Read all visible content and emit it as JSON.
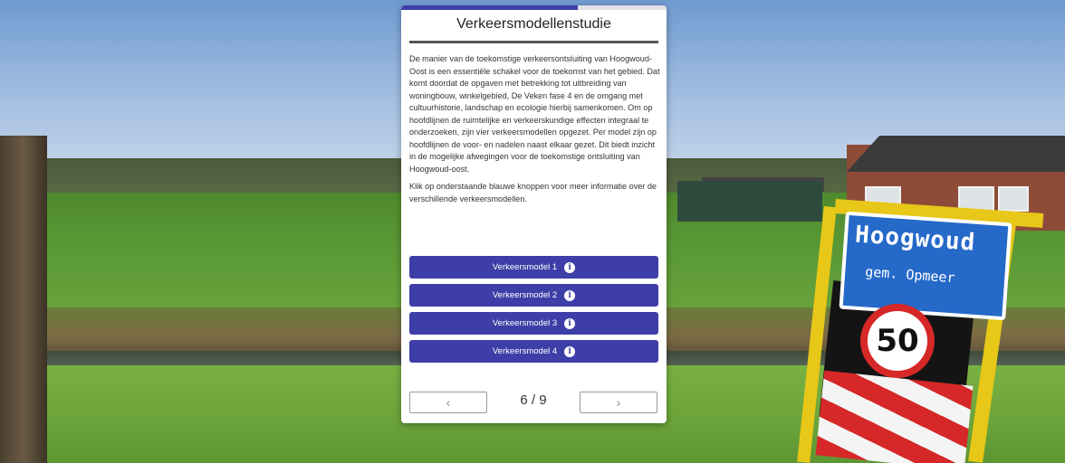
{
  "dialog": {
    "title": "Verkeersmodellenstudie",
    "progress_fraction": 0.667,
    "paragraph1": "De manier van de toekomstige verkeersontsluiting van Hoogwoud-Oost is een essentiële schakel voor de toekomst van het gebied. Dat komt doordat de opgaven met betrekking tot uitbreiding van woningbouw, winkelgebied, De Veken fase 4 en de omgang met cultuurhistorie, landschap en ecologie hierbij samenkomen. Om op hoofdlijnen de ruimtelijke en verkeerskundige effecten integraal te onderzoeken, zijn vier verkeersmodellen opgezet. Per model zijn op hoofdlijnen de voor- en nadelen naast elkaar gezet. Dit biedt inzicht in de mogelijke afwegingen voor de toekomstige ontsluiting van Hoogwoud-oost.",
    "paragraph2": "Klik op onderstaande blauwe knoppen voor meer informatie over de verschillende verkeersmodellen.",
    "buttons": [
      {
        "label": "Verkeersmodel 1"
      },
      {
        "label": "Verkeersmodel 2"
      },
      {
        "label": "Verkeersmodel 3"
      },
      {
        "label": "Verkeersmodel 4"
      }
    ],
    "info_glyph": "i",
    "pager": {
      "text": "6 / 9",
      "prev_glyph": "‹",
      "next_glyph": "›"
    },
    "accent_color": "#3e3ea8"
  },
  "background": {
    "sign": {
      "town": "Hoogwoud",
      "municipality": "gem. Opmeer",
      "speed_limit": "50"
    }
  }
}
